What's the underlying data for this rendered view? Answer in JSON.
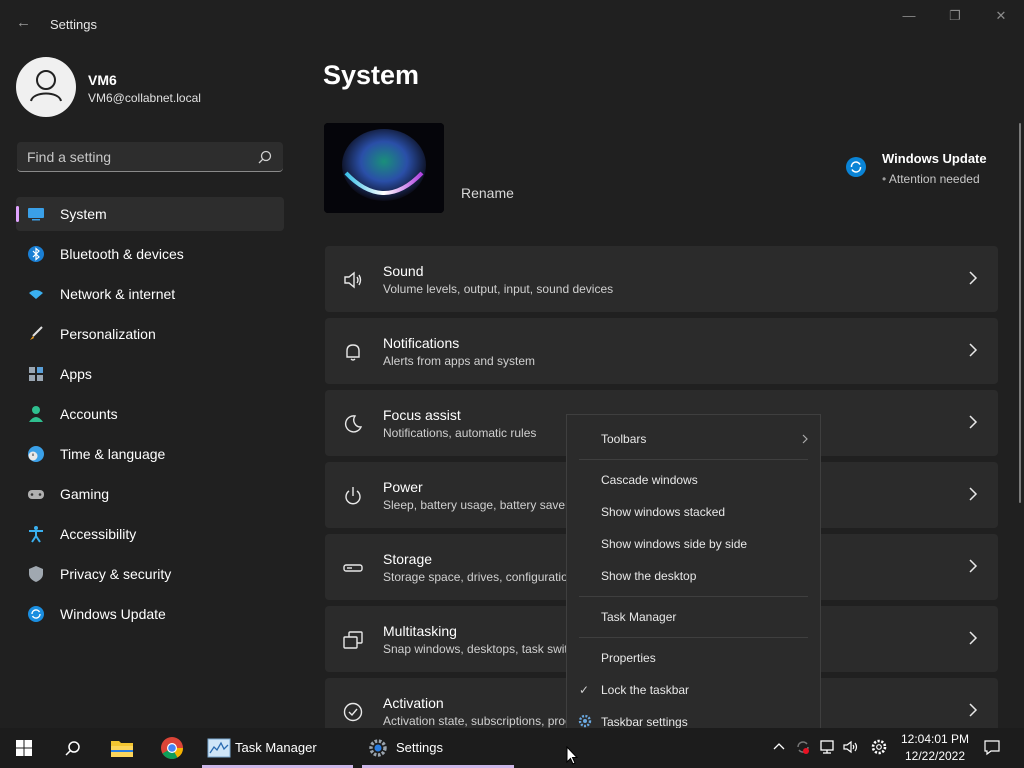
{
  "window": {
    "title": "Settings",
    "back_glyph": "←",
    "minimize_glyph": "—",
    "maximize_glyph": "❐",
    "close_glyph": "✕"
  },
  "user": {
    "name": "VM6",
    "email": "VM6@collabnet.local"
  },
  "search": {
    "placeholder": "Find a setting"
  },
  "sidebar": {
    "items": [
      {
        "label": "System",
        "icon": "system-icon"
      },
      {
        "label": "Bluetooth & devices",
        "icon": "bluetooth-icon"
      },
      {
        "label": "Network & internet",
        "icon": "network-icon"
      },
      {
        "label": "Personalization",
        "icon": "brush-icon"
      },
      {
        "label": "Apps",
        "icon": "apps-icon"
      },
      {
        "label": "Accounts",
        "icon": "accounts-icon"
      },
      {
        "label": "Time & language",
        "icon": "clock-globe-icon"
      },
      {
        "label": "Gaming",
        "icon": "gamepad-icon"
      },
      {
        "label": "Accessibility",
        "icon": "accessibility-icon"
      },
      {
        "label": "Privacy & security",
        "icon": "shield-icon"
      },
      {
        "label": "Windows Update",
        "icon": "update-icon"
      }
    ]
  },
  "main": {
    "title": "System",
    "rename": "Rename",
    "update": {
      "title": "Windows Update",
      "status": "Attention needed"
    },
    "cards": [
      {
        "title": "Sound",
        "subtitle": "Volume levels, output, input, sound devices",
        "icon": "speaker-icon"
      },
      {
        "title": "Notifications",
        "subtitle": "Alerts from apps and system",
        "icon": "bell-icon"
      },
      {
        "title": "Focus assist",
        "subtitle": "Notifications, automatic rules",
        "icon": "moon-icon"
      },
      {
        "title": "Power",
        "subtitle": "Sleep, battery usage, battery saver",
        "icon": "power-icon"
      },
      {
        "title": "Storage",
        "subtitle": "Storage space, drives, configuration rules",
        "icon": "storage-icon"
      },
      {
        "title": "Multitasking",
        "subtitle": "Snap windows, desktops, task switching",
        "icon": "multitasking-icon"
      },
      {
        "title": "Activation",
        "subtitle": "Activation state, subscriptions, product key",
        "icon": "check-circle-icon"
      }
    ]
  },
  "context_menu": {
    "items": [
      {
        "label": "Toolbars",
        "has_submenu": true
      },
      {
        "label": "Cascade windows"
      },
      {
        "label": "Show windows stacked"
      },
      {
        "label": "Show windows side by side"
      },
      {
        "label": "Show the desktop"
      },
      {
        "label": "Task Manager"
      },
      {
        "label": "Properties"
      },
      {
        "label": "Lock the taskbar",
        "checked": true,
        "check_glyph": "✓"
      },
      {
        "label": "Taskbar settings",
        "icon": "gear-icon"
      }
    ]
  },
  "taskbar": {
    "apps": [
      {
        "label": "Task Manager"
      },
      {
        "label": "Settings"
      }
    ],
    "clock": {
      "time": "12:04:01 PM",
      "date": "12/22/2022"
    }
  },
  "colors": {
    "accent": "#e0a3ff",
    "background": "#202020",
    "card": "#2b2b2b",
    "update_blue": "#0a84d6"
  }
}
